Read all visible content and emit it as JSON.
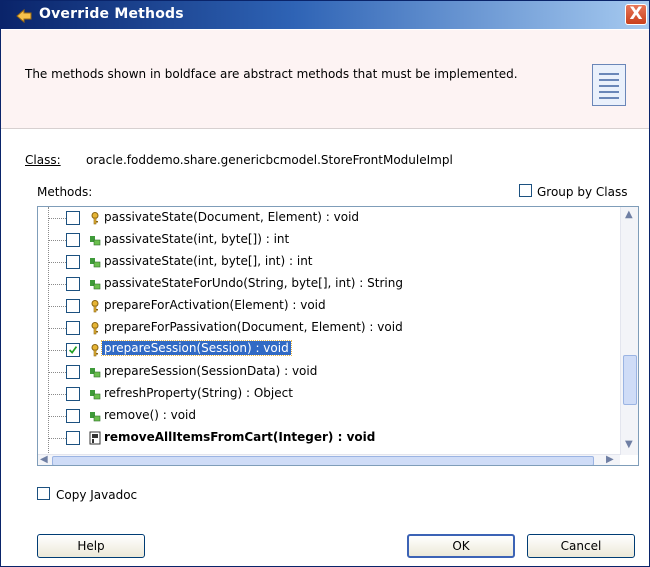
{
  "window": {
    "title": "Override Methods",
    "close_glyph": "X"
  },
  "banner": {
    "text": "The methods shown in boldface are abstract methods that must be implemented.",
    "icon": "document-icon"
  },
  "class_label": "Class:",
  "class_value": "oracle.foddemo.share.genericbcmodel.StoreFrontModuleImpl",
  "methods_label": "Methods:",
  "group_by_class": {
    "label": "Group by Class",
    "checked": false
  },
  "methods": [
    {
      "label": "passivateState(Document, Element) : void",
      "checked": false,
      "icon": "key-icon",
      "bold": false,
      "selected": false
    },
    {
      "label": "passivateState(int, byte[]) : int",
      "checked": false,
      "icon": "protected-method-icon",
      "bold": false,
      "selected": false
    },
    {
      "label": "passivateState(int, byte[], int) : int",
      "checked": false,
      "icon": "protected-method-icon",
      "bold": false,
      "selected": false
    },
    {
      "label": "passivateStateForUndo(String, byte[], int) : String",
      "checked": false,
      "icon": "protected-method-icon",
      "bold": false,
      "selected": false
    },
    {
      "label": "prepareForActivation(Element) : void",
      "checked": false,
      "icon": "key-icon",
      "bold": false,
      "selected": false
    },
    {
      "label": "prepareForPassivation(Document, Element) : void",
      "checked": false,
      "icon": "key-icon",
      "bold": false,
      "selected": false
    },
    {
      "label": "prepareSession(Session) : void",
      "checked": true,
      "icon": "key-icon",
      "bold": false,
      "selected": true
    },
    {
      "label": "prepareSession(SessionData) : void",
      "checked": false,
      "icon": "protected-method-icon",
      "bold": false,
      "selected": false
    },
    {
      "label": "refreshProperty(String) : Object",
      "checked": false,
      "icon": "protected-method-icon",
      "bold": false,
      "selected": false
    },
    {
      "label": "remove() : void",
      "checked": false,
      "icon": "protected-method-icon",
      "bold": false,
      "selected": false
    },
    {
      "label": "removeAllItemsFromCart(Integer) : void",
      "checked": false,
      "icon": "abstract-method-icon",
      "bold": true,
      "selected": false
    }
  ],
  "copy_javadoc": {
    "label": "Copy Javadoc",
    "checked": false
  },
  "buttons": {
    "help": "Help",
    "ok": "OK",
    "cancel": "Cancel"
  },
  "colors": {
    "selection": "#316ac5",
    "banner_bg": "#fdf3f3",
    "title_bar": "#0a246a"
  }
}
